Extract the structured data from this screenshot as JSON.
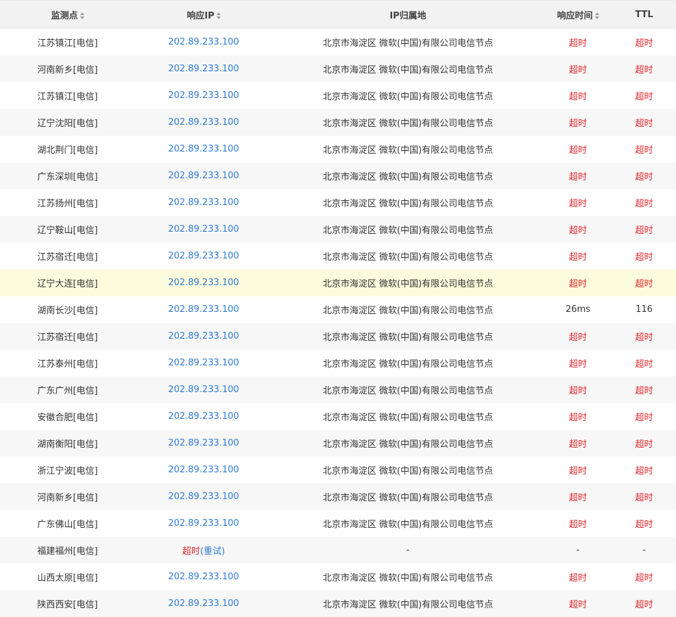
{
  "table": {
    "headers": {
      "monitor_point": "监测点",
      "response_ip": "响应IP",
      "ip_location": "IP归属地",
      "response_time": "响应时间",
      "ttl": "TTL"
    },
    "rows": [
      {
        "point": "江苏镇江[电信]",
        "ip": "202.89.233.100",
        "location": "北京市海淀区 微软(中国)有限公司电信节点",
        "time": "超时",
        "ttl": "超时"
      },
      {
        "point": "河南新乡[电信]",
        "ip": "202.89.233.100",
        "location": "北京市海淀区 微软(中国)有限公司电信节点",
        "time": "超时",
        "ttl": "超时"
      },
      {
        "point": "江苏镇江[电信]",
        "ip": "202.89.233.100",
        "location": "北京市海淀区 微软(中国)有限公司电信节点",
        "time": "超时",
        "ttl": "超时"
      },
      {
        "point": "辽宁沈阳[电信]",
        "ip": "202.89.233.100",
        "location": "北京市海淀区 微软(中国)有限公司电信节点",
        "time": "超时",
        "ttl": "超时"
      },
      {
        "point": "湖北荆门[电信]",
        "ip": "202.89.233.100",
        "location": "北京市海淀区 微软(中国)有限公司电信节点",
        "time": "超时",
        "ttl": "超时"
      },
      {
        "point": "广东深圳[电信]",
        "ip": "202.89.233.100",
        "location": "北京市海淀区 微软(中国)有限公司电信节点",
        "time": "超时",
        "ttl": "超时"
      },
      {
        "point": "江苏扬州[电信]",
        "ip": "202.89.233.100",
        "location": "北京市海淀区 微软(中国)有限公司电信节点",
        "time": "超时",
        "ttl": "超时"
      },
      {
        "point": "辽宁鞍山[电信]",
        "ip": "202.89.233.100",
        "location": "北京市海淀区 微软(中国)有限公司电信节点",
        "time": "超时",
        "ttl": "超时"
      },
      {
        "point": "江苏宿迁[电信]",
        "ip": "202.89.233.100",
        "location": "北京市海淀区 微软(中国)有限公司电信节点",
        "time": "超时",
        "ttl": "超时"
      },
      {
        "point": "辽宁大连[电信]",
        "ip": "202.89.233.100",
        "location": "北京市海淀区 微软(中国)有限公司电信节点",
        "time": "超时",
        "ttl": "超时"
      },
      {
        "point": "湖南长沙[电信]",
        "ip": "202.89.233.100",
        "location": "北京市海淀区 微软(中国)有限公司电信节点",
        "time": "26ms",
        "ttl": "116"
      },
      {
        "point": "江苏宿迁[电信]",
        "ip": "202.89.233.100",
        "location": "北京市海淀区 微软(中国)有限公司电信节点",
        "time": "超时",
        "ttl": "超时"
      },
      {
        "point": "江苏泰州[电信]",
        "ip": "202.89.233.100",
        "location": "北京市海淀区 微软(中国)有限公司电信节点",
        "time": "超时",
        "ttl": "超时"
      },
      {
        "point": "广东广州[电信]",
        "ip": "202.89.233.100",
        "location": "北京市海淀区 微软(中国)有限公司电信节点",
        "time": "超时",
        "ttl": "超时"
      },
      {
        "point": "安徽合肥[电信]",
        "ip": "202.89.233.100",
        "location": "北京市海淀区 微软(中国)有限公司电信节点",
        "time": "超时",
        "ttl": "超时"
      },
      {
        "point": "湖南衡阳[电信]",
        "ip": "202.89.233.100",
        "location": "北京市海淀区 微软(中国)有限公司电信节点",
        "time": "超时",
        "ttl": "超时"
      },
      {
        "point": "浙江宁波[电信]",
        "ip": "202.89.233.100",
        "location": "北京市海淀区 微软(中国)有限公司电信节点",
        "time": "超时",
        "ttl": "超时"
      },
      {
        "point": "河南新乡[电信]",
        "ip": "202.89.233.100",
        "location": "北京市海淀区 微软(中国)有限公司电信节点",
        "time": "超时",
        "ttl": "超时"
      },
      {
        "point": "广东佛山[电信]",
        "ip": "202.89.233.100",
        "location": "北京市海淀区 微软(中国)有限公司电信节点",
        "time": "超时",
        "ttl": "超时"
      },
      {
        "point": "福建福州[电信]",
        "ip_timeout": "超时",
        "retry": "(重试)",
        "location": "-",
        "time": "-",
        "ttl": "-"
      },
      {
        "point": "山西太原[电信]",
        "ip": "202.89.233.100",
        "location": "北京市海淀区 微软(中国)有限公司电信节点",
        "time": "超时",
        "ttl": "超时"
      },
      {
        "point": "陕西西安[电信]",
        "ip": "202.89.233.100",
        "location": "北京市海淀区 微软(中国)有限公司电信节点",
        "time": "超时",
        "ttl": "超时"
      }
    ]
  },
  "colors": {
    "ip_link": "#2e7bd4",
    "timeout": "#e0262a",
    "highlight_row": "#fdfbdd"
  }
}
